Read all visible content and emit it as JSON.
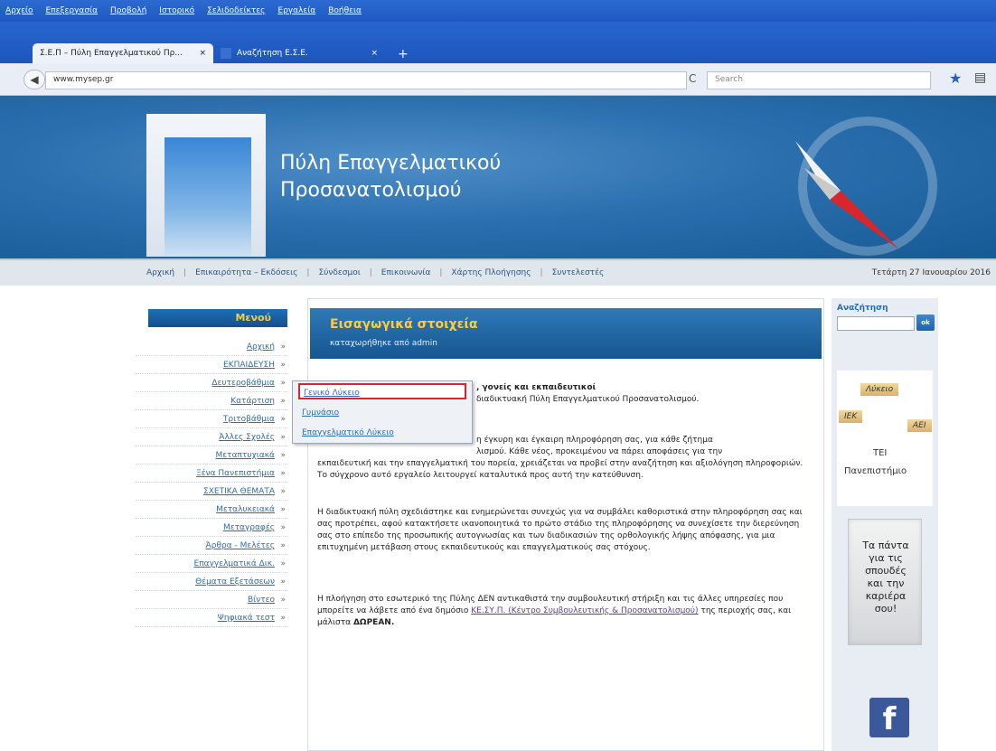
{
  "browser": {
    "menu": [
      "Αρχείο",
      "Επεξεργασία",
      "Προβολή",
      "Ιστορικό",
      "Σελιδοδείκτες",
      "Εργαλεία",
      "Βοήθεια"
    ],
    "tabs": [
      {
        "title": "Σ.Ε.Π – Πύλη Επαγγελματικού Πρ...",
        "close": "×"
      },
      {
        "title": "Αναζήτηση Ε.Σ.Ε.",
        "close": "×"
      }
    ],
    "new_tab": "+",
    "url": "www.mysep.gr",
    "search_placeholder": "Search",
    "back": "◀",
    "reload": "C",
    "star": "★",
    "bookmarks": "▤"
  },
  "header": {
    "title_line1": "Πύλη Επαγγελματικού",
    "title_line2": "Προσανατολισμού"
  },
  "topnav": {
    "items": [
      "Αρχική",
      "Επικαιρότητα – Εκδόσεις",
      "Σύνδεσμοι",
      "Επικοινωνία",
      "Χάρτης Πλοήγησης",
      "Συντελεστές"
    ],
    "sep": "|",
    "date": "Τετάρτη 27 Ιανουαρίου 2016"
  },
  "sidebar": {
    "heading": "Μενού",
    "items": [
      "Αρχική",
      "ΕΚΠΑΙΔΕΥΣΗ",
      "Δευτεροβάθμια",
      "Κατάρτιση",
      "Τριτοβάθμια",
      "Άλλες Σχολές",
      "Μεταπτυχιακά",
      "Ξένα Πανεπιστήμια",
      "ΣΧΕΤΙΚΑ ΘΕΜΑΤΑ",
      "Μεταλυκειακά",
      "Μεταγραφές",
      "Άρθρα - Μελέτες",
      "Επαγγελματικά Δικ.",
      "Θέματα Εξετάσεων",
      "Βίντεο",
      "Ψηφιακά τεστ"
    ],
    "arrow": "»"
  },
  "dropdown": {
    "items": [
      "Γενικό Λύκειο",
      "Γυμνάσιο",
      "Επαγγελματικό Λύκειο"
    ]
  },
  "content": {
    "heading": "Εισαγωγικά στοιχεία",
    "subheading": "καταχωρήθηκε από admin",
    "p1_bold": ", γονείς και εκπαιδευτικοί",
    "p1_rest": "διαδικτυακή Πύλη Επαγγελματικού Προσανατολισμού.",
    "p2_a": "η έγκυρη και έγκαιρη πληροφόρηση σας, για κάθε ζήτημα",
    "p2_b": "λισμού. Κάθε νέος, προκειμένου να πάρει αποφάσεις για την",
    "p2_c": "εκπαιδευτική και την επαγγελματική του πορεία, χρειάζεται να προβεί στην αναζήτηση και αξιολόγηση πληροφοριών. Το σύγχρονο αυτό εργαλείο λειτουργεί καταλυτικά προς αυτή την κατεύθυνση.",
    "p3": "Η διαδικτυακή πύλη σχεδιάστηκε και ενημερώνεται συνεχώς για να συμβάλει καθοριστικά στην πληροφόρηση σας και σας προτρέπει, αφού κατακτήσετε ικανοποιητικά το πρώτο στάδιο της πληροφόρησης να συνεχίσετε την διερεύνηση σας στο επίπεδο της προσωπικής αυτογνωσίας και των διαδικασιών της ορθολογικής λήψης απόφασης, για μια επιτυχημένη μετάβαση στους εκπαιδευτικούς και επαγγελματικούς σας στόχους.",
    "p4_a": "Η πλοήγηση στο εσωτερικό της Πύλης ΔΕΝ αντικαθιστά την συμβουλευτική στήριξη και τις άλλες υπηρεσίες που μπορείτε να λάβετε από ένα δημόσιο",
    "p4_link1": "ΚΕ.ΣΥ.Π. (Κέντρο Συμβουλευτικής & Προσανατολισμού)",
    "p4_b": "της περιοχής σας, και μάλιστα",
    "p4_bold": "ΔΩΡΕΑΝ."
  },
  "rightbar": {
    "search_label": "Αναζήτηση",
    "ok": "ok",
    "tags": [
      "Λύκειο",
      "ΙΕΚ",
      "ΑΕΙ",
      "ΤΕΙ",
      "Πανεπιστήμιο"
    ],
    "sign_lines": [
      "Τα πάντα",
      "για τις",
      "σπουδές",
      "και την",
      "καριέρα",
      "σου!"
    ],
    "fb": "f"
  }
}
